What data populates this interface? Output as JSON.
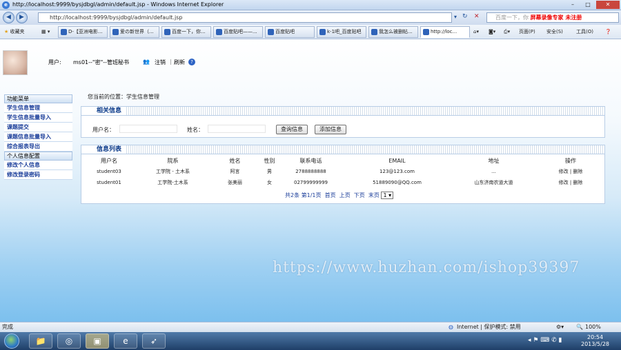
{
  "window": {
    "title": "http://localhost:9999/bysjdbgl/admin/default.jsp - Windows Internet Explorer",
    "min": "–",
    "max": "□",
    "close": "✕"
  },
  "address": {
    "url": "http://localhost:9999/bysjdbgl/admin/default.jsp",
    "search_hint": "百度一下，你",
    "search_red": "屏幕录像专家  未注册"
  },
  "favbar": {
    "favorites_label": "收藏夹",
    "tabs": [
      "D-【亚洲电影...",
      "爱の新世界（...",
      "百度一下，你...",
      "百度贴吧——...",
      "百度贴吧",
      "k-1吧_百度贴吧",
      "我怎么被删帖...",
      "http://loc..."
    ],
    "menu": [
      "页面(P)",
      "安全(S)",
      "工具(O)"
    ]
  },
  "header": {
    "user_label": "用户:",
    "user_value": "ms01--\"密\"--管班秘书",
    "logout": "注销",
    "refresh": "刷新"
  },
  "sidebar": {
    "section1": "功能菜单",
    "items1": [
      "学生信息管理",
      "学生信息批量导入",
      "课题提交",
      "课题信息批量导入",
      "综合报表导出"
    ],
    "section2": "个人信息配置",
    "items2": [
      "修改个人信息",
      "修改登录密码"
    ]
  },
  "breadcrumb": "您当前的位置：学生信息管理",
  "search_panel": {
    "title": "相关信息",
    "username_label": "用户名：",
    "name_label": "姓名：",
    "query_button": "查询信息",
    "add_button": "添加信息"
  },
  "list_panel": {
    "title": "信息列表",
    "columns": [
      "用户名",
      "院系",
      "姓名",
      "性别",
      "联系电话",
      "EMAIL",
      "地址",
      "操作"
    ],
    "rows": [
      {
        "username": "student03",
        "dept": "工学院 - 土木系",
        "name": "阿言",
        "gender": "男",
        "phone": "2788888888",
        "email": "123@123.com",
        "address": "...",
        "edit": "修改",
        "delete": "删除"
      },
      {
        "username": "student01",
        "dept": "工学院-土木系",
        "name": "张美丽",
        "gender": "女",
        "phone": "02799999999",
        "email": "51889090@QQ.com",
        "address": "山东济南农道大道",
        "edit": "修改",
        "delete": "删除"
      }
    ],
    "pager": {
      "total": "共2条",
      "page": "第1/1页",
      "first": "首页",
      "prev": "上页",
      "next": "下页",
      "last": "末页",
      "select": "1"
    }
  },
  "watermark": "https://www.huzhan.com/ishop39397",
  "status": {
    "left": "完成",
    "zone": "Internet | 保护模式: 禁用",
    "zoom": "100%"
  },
  "clock": {
    "time": "20:54",
    "date": "2013/5/28"
  }
}
